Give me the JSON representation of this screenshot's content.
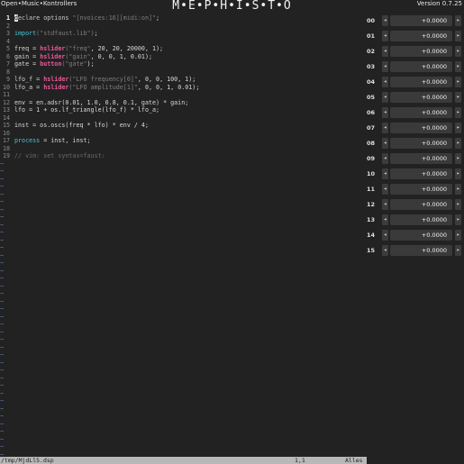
{
  "header": {
    "brand": "Open•Music•Kontrollers",
    "title": "M•E•P•H•I•S•T•O",
    "version": "Version 0.7.25"
  },
  "editor": {
    "lines": [
      {
        "n": "1"
      },
      {
        "n": "2"
      },
      {
        "n": "3"
      },
      {
        "n": "4"
      },
      {
        "n": "5"
      },
      {
        "n": "6"
      },
      {
        "n": "7"
      },
      {
        "n": "8"
      },
      {
        "n": "9"
      },
      {
        "n": "10"
      },
      {
        "n": "11"
      },
      {
        "n": "12"
      },
      {
        "n": "13"
      },
      {
        "n": "14"
      },
      {
        "n": "15"
      },
      {
        "n": "16"
      },
      {
        "n": "17"
      },
      {
        "n": "18"
      },
      {
        "n": "19"
      }
    ],
    "code": {
      "l1_cursor": "d",
      "l1_rest": "eclare options ",
      "l1_str": "\"[nvoices:16][midi:on]\"",
      "l1_end": ";",
      "l3_kw": "import",
      "l3_str": "(\"stdfaust.lib\")",
      "l3_end": ";",
      "l5_a": "freq = ",
      "l5_fn": "hslider",
      "l5_str": "(\"freq\"",
      "l5_rest": ", 20, 20, 20000, 1);",
      "l6_a": "gain = ",
      "l6_fn": "hslider",
      "l6_str": "(\"gain\"",
      "l6_rest": ", 0, 0, 1, 0.01);",
      "l7_a": "gate = ",
      "l7_fn": "button",
      "l7_str": "(\"gate\"",
      "l7_rest": ");",
      "l9_a": "lfo_f = ",
      "l9_fn": "hslider",
      "l9_str": "(\"LFO frequency[0]\"",
      "l9_rest": ", 0, 0, 100, 1);",
      "l10_a": "lfo_a = ",
      "l10_fn": "hslider",
      "l10_str": "(\"LFO amplitude[1]\"",
      "l10_rest": ", 0, 0, 1, 0.01);",
      "l12": "env = en.adsr(0.01, 1.0, 0.8, 0.1, gate) * gain;",
      "l13": "lfo = 1 + os.lf_triangle(lfo_f) * lfo_a;",
      "l15": "inst = os.oscs(freq * lfo) * env / 4;",
      "l17_kw": "process",
      "l17_rest": " = inst, inst;",
      "l19": "// vim: set syntax=faust:"
    },
    "tilde": "~"
  },
  "status": {
    "file": "/tmp/MjdLl5.dsp",
    "position": "1,1",
    "scroll": "Alles"
  },
  "controls": {
    "dec_icon": "◂",
    "inc_icon": "▸",
    "items": [
      {
        "id": "00",
        "value": "+0.0000"
      },
      {
        "id": "01",
        "value": "+0.0000"
      },
      {
        "id": "02",
        "value": "+0.0000"
      },
      {
        "id": "03",
        "value": "+0.0000"
      },
      {
        "id": "04",
        "value": "+0.0000"
      },
      {
        "id": "05",
        "value": "+0.0000"
      },
      {
        "id": "06",
        "value": "+0.0000"
      },
      {
        "id": "07",
        "value": "+0.0000"
      },
      {
        "id": "08",
        "value": "+0.0000"
      },
      {
        "id": "09",
        "value": "+0.0000"
      },
      {
        "id": "10",
        "value": "+0.0000"
      },
      {
        "id": "11",
        "value": "+0.0000"
      },
      {
        "id": "12",
        "value": "+0.0000"
      },
      {
        "id": "13",
        "value": "+0.0000"
      },
      {
        "id": "14",
        "value": "+0.0000"
      },
      {
        "id": "15",
        "value": "+0.0000"
      }
    ]
  }
}
